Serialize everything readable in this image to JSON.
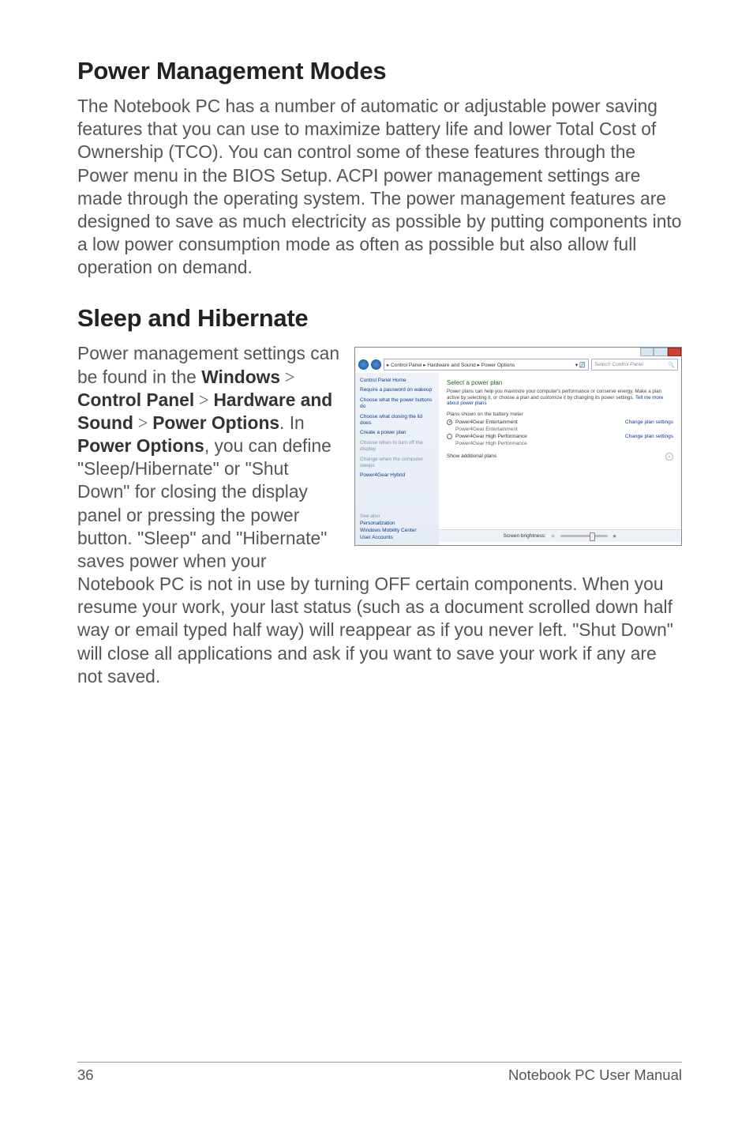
{
  "headings": {
    "power_mgmt": "Power Management Modes",
    "sleep_hib": "Sleep and Hibernate"
  },
  "paragraphs": {
    "pm_intro": "The Notebook PC has a number of automatic or adjustable power saving features that you can use to maximize battery life and lower Total Cost of Ownership (TCO). You can control some of these features through the Power menu in the BIOS Setup. ACPI power management settings are made through the operating system. The power management features are designed to save as much electricity as possible by putting components into a low power consumption mode as often as possible but also allow full operation on demand.",
    "sleep_left_1": "Power management settings can be found in the ",
    "win": "Windows",
    "gt1": " > ",
    "cp": "Control Panel",
    "gt2": " > ",
    "hw": "Hardware and Sound",
    "gt3": " > ",
    "po": "Power Options",
    "sleep_left_2": ". In ",
    "po2": "Power Options",
    "sleep_left_3": ", you can define \"Sleep/Hibernate\" or \"Shut Down\" for closing the display panel or pressing the power button.",
    "after_img": "\"Sleep\" and \"Hibernate\" saves power when your Notebook PC is not in use by turning OFF certain components. When you resume your work, your last status (such as a document scrolled down half way or email typed half way) will reappear as if you never left. \"Shut Down\" will close all applications and ask if you want to save your work if any are not saved."
  },
  "screenshot": {
    "breadcrumb": "▸ Control Panel ▸ Hardware and Sound ▸ Power Options",
    "search_placeholder": "Search Control Panel",
    "sidebar": {
      "home": "Control Panel Home",
      "links": [
        "Require a password on wakeup",
        "Choose what the power buttons do",
        "Choose what closing the lid does",
        "Create a power plan",
        "Choose when to turn off the display",
        "Change when the computer sleeps",
        "Power4Gear Hybrid"
      ],
      "see_also_hdr": "See also",
      "see_also": [
        "Personalization",
        "Windows Mobility Center",
        "User Accounts"
      ]
    },
    "main": {
      "title": "Select a power plan",
      "desc_pre": "Power plans can help you maximize your computer's performance or conserve energy. Make a plan active by selecting it, or choose a plan and customize it by changing its power settings. ",
      "desc_link": "Tell me more about power plans",
      "group1": "Plans shown on the battery meter",
      "plan1": "Power4Gear Entertainment",
      "plan1_sub": "Power4Gear Entertainment",
      "plan2": "Power4Gear High Performance",
      "plan2_sub": "Power4Gear High Performance",
      "change": "Change plan settings",
      "show_more": "Show additional plans",
      "brightness": "Screen brightness:"
    }
  },
  "footer": {
    "page": "36",
    "doc": "Notebook PC User Manual"
  },
  "chart_data": null
}
